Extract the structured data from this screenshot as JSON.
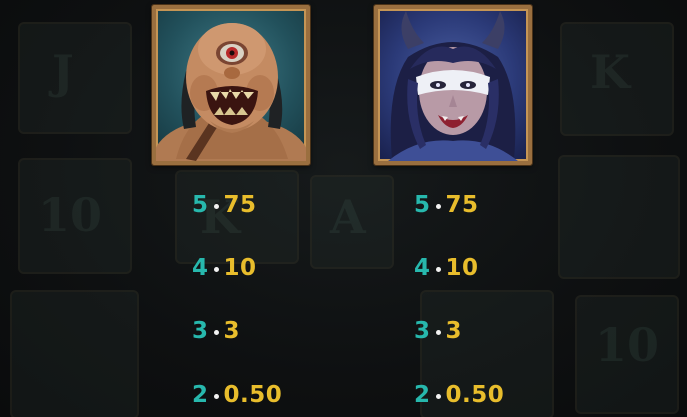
{
  "colors": {
    "count_teal": "#27b8ad",
    "payout_gold": "#e8bd2c",
    "frame_bronze": "#9a6f3f",
    "background": "#0d0f10"
  },
  "symbols": [
    {
      "icon": "cyclops-ogre-icon",
      "paytable": [
        {
          "count": "5",
          "value": "75"
        },
        {
          "count": "4",
          "value": "10"
        },
        {
          "count": "3",
          "value": "3"
        },
        {
          "count": "2",
          "value": "0.50"
        }
      ]
    },
    {
      "icon": "demoness-icon",
      "paytable": [
        {
          "count": "5",
          "value": "75"
        },
        {
          "count": "4",
          "value": "10"
        },
        {
          "count": "3",
          "value": "3"
        },
        {
          "count": "2",
          "value": "0.50"
        }
      ]
    }
  ],
  "background_glyphs": [
    "J",
    "K",
    "10",
    "K",
    "A",
    "10"
  ]
}
